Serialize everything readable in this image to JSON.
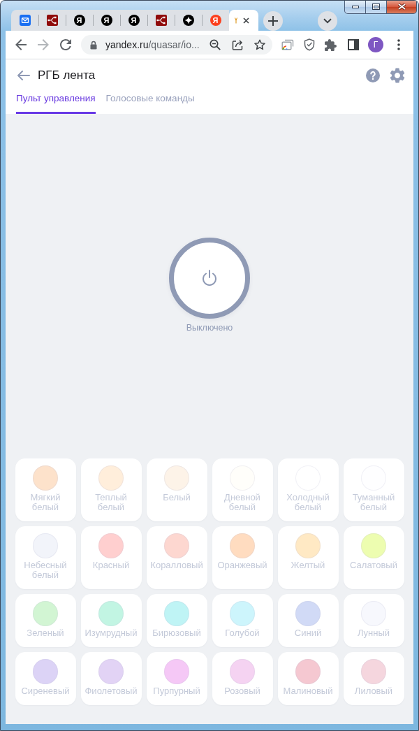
{
  "browser": {
    "tabs": [
      {
        "kind": "mail",
        "selected": false
      },
      {
        "kind": "flow",
        "selected": false
      },
      {
        "kind": "letter",
        "letter": "Я",
        "color": "#000000",
        "selected": false
      },
      {
        "kind": "letter",
        "letter": "Я",
        "color": "#000000",
        "selected": false
      },
      {
        "kind": "letter",
        "letter": "Я",
        "color": "#000000",
        "selected": false
      },
      {
        "kind": "flow",
        "selected": false
      },
      {
        "kind": "sparkle",
        "selected": false
      },
      {
        "kind": "letter",
        "letter": "Я",
        "color": "#fc3f1d",
        "selected": false
      },
      {
        "kind": "clipped",
        "selected": true
      }
    ],
    "address": {
      "host": "yandex.ru",
      "path": "/quasar/io..."
    },
    "profile": "Г"
  },
  "page": {
    "title": "РГБ лента",
    "tabs": [
      {
        "label": "Пульт управления",
        "selected": true
      },
      {
        "label": "Голосовые команды",
        "selected": false
      }
    ],
    "power": {
      "on": false,
      "status": "Выключено"
    },
    "colors": [
      {
        "name": "Мягкий белый",
        "color": "#fde2cb"
      },
      {
        "name": "Теплый белый",
        "color": "#ffeedb"
      },
      {
        "name": "Белый",
        "color": "#fdf3e8"
      },
      {
        "name": "Дневной белый",
        "color": "#fffefa"
      },
      {
        "name": "Холодный белый",
        "color": "#ffffff"
      },
      {
        "name": "Туманный белый",
        "color": "#fefeff"
      },
      {
        "name": "Небесный белый",
        "color": "#f2f4fa"
      },
      {
        "name": "Красный",
        "color": "#ffcfcf"
      },
      {
        "name": "Коралловый",
        "color": "#fdd7d0"
      },
      {
        "name": "Оранжевый",
        "color": "#ffdcc0"
      },
      {
        "name": "Желтый",
        "color": "#ffe9c4"
      },
      {
        "name": "Салатовый",
        "color": "#edfdb0"
      },
      {
        "name": "Зеленый",
        "color": "#d2f5d3"
      },
      {
        "name": "Изумрудный",
        "color": "#c2f5e3"
      },
      {
        "name": "Бирюзовый",
        "color": "#bff4f5"
      },
      {
        "name": "Голубой",
        "color": "#cdf5fc"
      },
      {
        "name": "Синий",
        "color": "#d1daf6"
      },
      {
        "name": "Лунный",
        "color": "#f7f8fd"
      },
      {
        "name": "Сиреневый",
        "color": "#dcd3f6"
      },
      {
        "name": "Фиолетовый",
        "color": "#e2d3f5"
      },
      {
        "name": "Пурпурный",
        "color": "#f5c8f6"
      },
      {
        "name": "Розовый",
        "color": "#f5d3f2"
      },
      {
        "name": "Малиновый",
        "color": "#f5c8d1"
      },
      {
        "name": "Лиловый",
        "color": "#f5d6de"
      }
    ]
  }
}
